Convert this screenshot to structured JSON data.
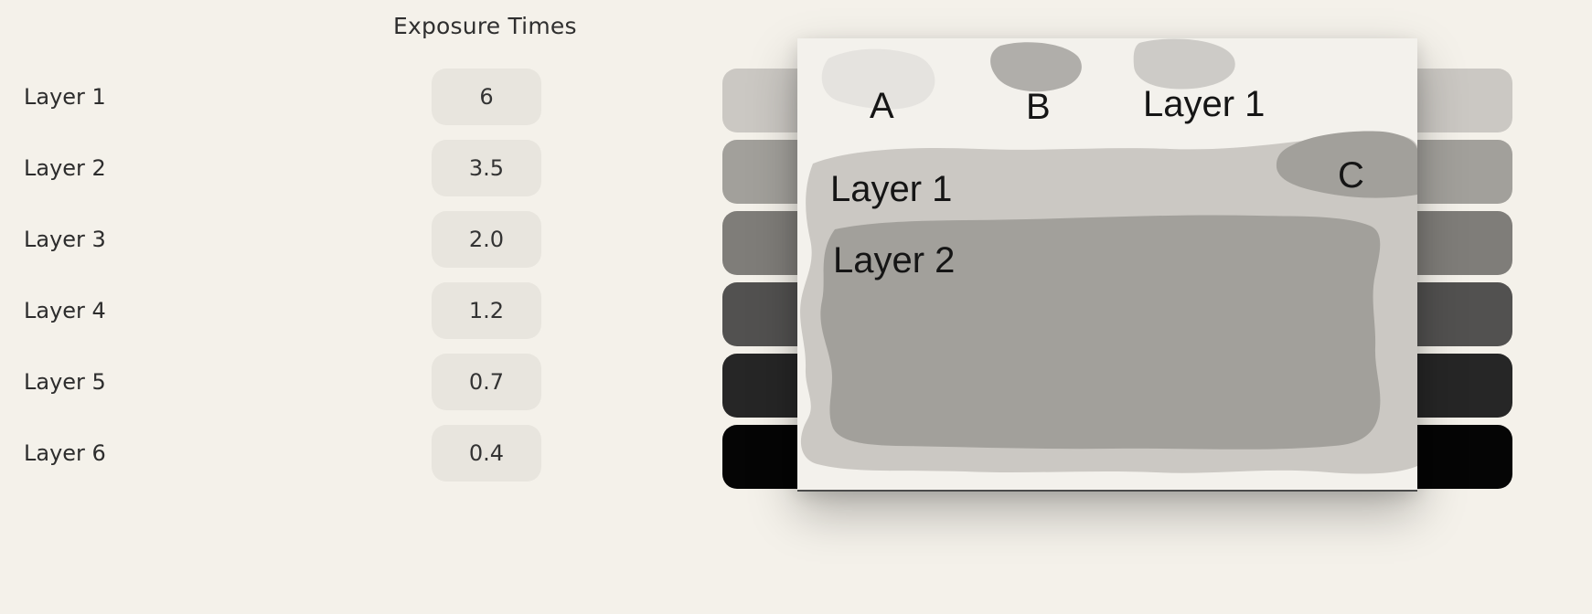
{
  "panel_title": "Exposure Times",
  "layers": [
    {
      "label": "Layer 1",
      "exposure": "6",
      "swatch_color": "#cbc8c3"
    },
    {
      "label": "Layer 2",
      "exposure": "3.5",
      "swatch_color": "#a2a09b"
    },
    {
      "label": "Layer 3",
      "exposure": "2.0",
      "swatch_color": "#7f7d79"
    },
    {
      "label": "Layer 4",
      "exposure": "1.2",
      "swatch_color": "#525150"
    },
    {
      "label": "Layer 5",
      "exposure": "0.7",
      "swatch_color": "#262626"
    },
    {
      "label": "Layer 6",
      "exposure": "0.4",
      "swatch_color": "#050505"
    }
  ],
  "sketch": {
    "labels": {
      "a": "A",
      "b": "B",
      "c": "C",
      "top_layer_1": "Layer 1",
      "layer_1": "Layer 1",
      "layer_2": "Layer 2"
    },
    "colors": {
      "panel_background": "#f3f1ec",
      "layer_1_fill": "#cbc8c3",
      "layer_2_fill": "#a2a09b",
      "blob_a": "#e5e3df",
      "blob_b": "#b0aeaa",
      "blob_top_layer_1": "#cdcbc7"
    }
  }
}
